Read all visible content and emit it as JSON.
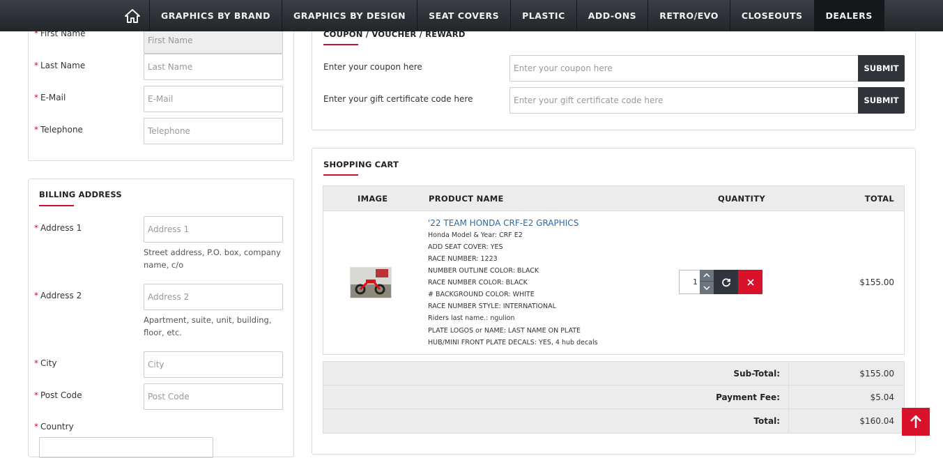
{
  "nav": {
    "items": [
      {
        "label": "GRAPHICS BY BRAND"
      },
      {
        "label": "GRAPHICS BY DESIGN"
      },
      {
        "label": "SEAT COVERS"
      },
      {
        "label": "PLASTIC"
      },
      {
        "label": "ADD-ONS"
      },
      {
        "label": "RETRO/EVO"
      },
      {
        "label": "CLOSEOUTS"
      },
      {
        "label": "DEALERS"
      }
    ]
  },
  "personal": {
    "first_name": {
      "label": "First Name",
      "placeholder": "First Name"
    },
    "last_name": {
      "label": "Last Name",
      "placeholder": "Last Name"
    },
    "email": {
      "label": "E-Mail",
      "placeholder": "E-Mail"
    },
    "telephone": {
      "label": "Telephone",
      "placeholder": "Telephone"
    }
  },
  "billing": {
    "title": "BILLING ADDRESS",
    "address1": {
      "label": "Address 1",
      "placeholder": "Address 1",
      "help": "Street address, P.O. box, company name, c/o"
    },
    "address2": {
      "label": "Address 2",
      "placeholder": "Address 2",
      "help": "Apartment, suite, unit, building, floor, etc."
    },
    "city": {
      "label": "City",
      "placeholder": "City"
    },
    "postcode": {
      "label": "Post Code",
      "placeholder": "Post Code"
    },
    "country": {
      "label": "Country"
    }
  },
  "coupon": {
    "title": "COUPON / VOUCHER / REWARD",
    "coupon_label": "Enter your coupon here",
    "coupon_placeholder": "Enter your coupon here",
    "gift_label": "Enter your gift certificate code here",
    "gift_placeholder": "Enter your gift certificate code here",
    "submit": "SUBMIT"
  },
  "cart": {
    "title": "SHOPPING CART",
    "headers": {
      "image": "IMAGE",
      "name": "PRODUCT NAME",
      "quantity": "QUANTITY",
      "total": "TOTAL"
    },
    "item": {
      "name": "'22 TEAM HONDA CRF-E2 GRAPHICS",
      "options": [
        "Honda Model & Year: CRF E2",
        "ADD SEAT COVER: YES",
        "RACE NUMBER: 1223",
        "NUMBER OUTLINE COLOR: BLACK",
        "RACE NUMBER COLOR: BLACK",
        "# BACKGROUND COLOR: WHITE",
        "RACE NUMBER STYLE: INTERNATIONAL",
        "Riders last name.: ngulion",
        "PLATE LOGOS or NAME: LAST NAME ON PLATE",
        "HUB/MINI FRONT PLATE DECALS: YES, 4 hub decals"
      ],
      "quantity": "1",
      "total": "$155.00"
    },
    "totals": [
      {
        "label": "Sub-Total:",
        "value": "$155.00"
      },
      {
        "label": "Payment Fee:",
        "value": "$5.04"
      },
      {
        "label": "Total:",
        "value": "$160.04"
      }
    ]
  },
  "colors": {
    "accent": "#c8102e",
    "dark": "#2f353b",
    "nav": "#2a2e33"
  }
}
